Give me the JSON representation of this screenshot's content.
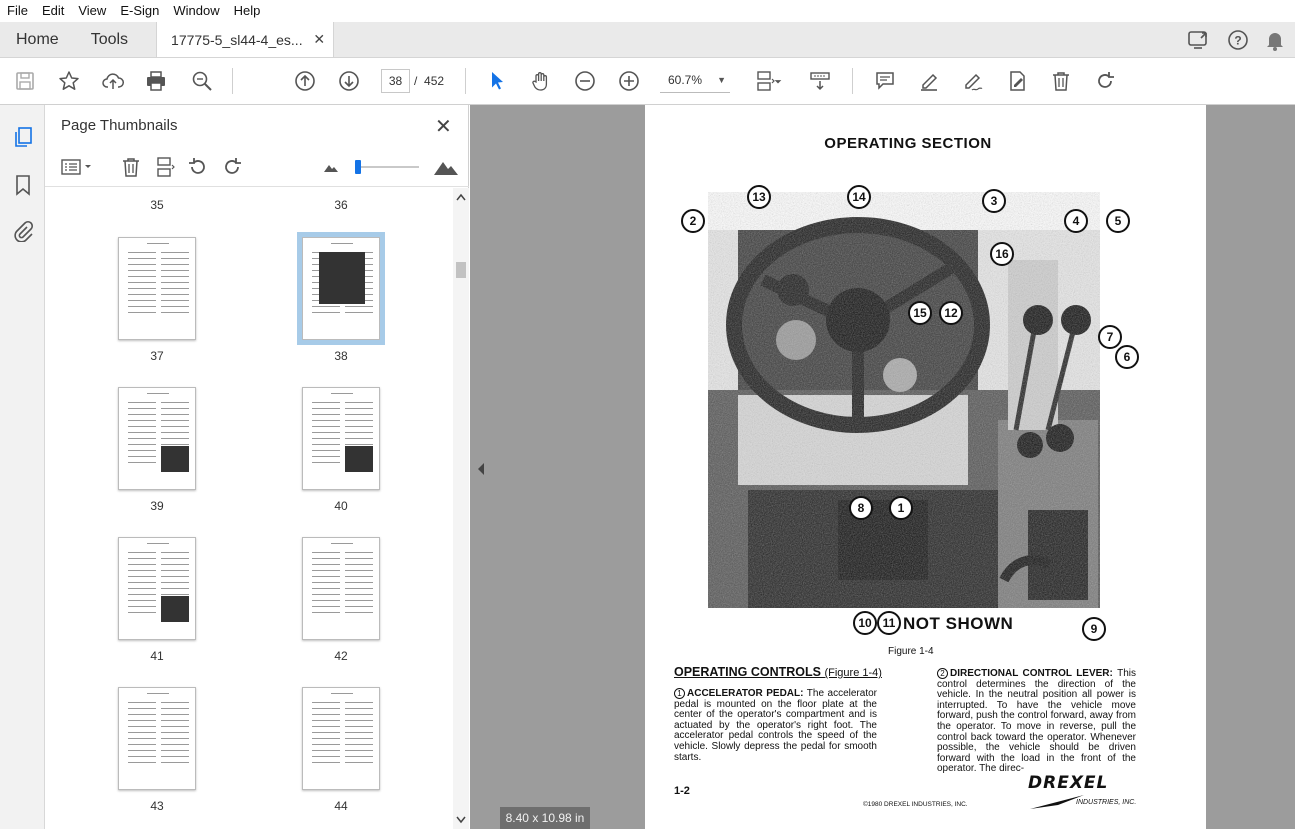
{
  "menu": [
    "File",
    "Edit",
    "View",
    "E-Sign",
    "Window",
    "Help"
  ],
  "tabs": {
    "home": "Home",
    "tools": "Tools",
    "document": "17775-5_sl44-4_es..."
  },
  "toolbar": {
    "current_page": "38",
    "page_sep": "/",
    "total_pages": "452",
    "zoom": "60.7%"
  },
  "panel": {
    "title": "Page Thumbnails",
    "slider_value": 0.02,
    "thumbnails": [
      {
        "label": "35"
      },
      {
        "label": "36"
      },
      {
        "label": "37"
      },
      {
        "label": "38",
        "selected": true
      },
      {
        "label": "39"
      },
      {
        "label": "40"
      },
      {
        "label": "41"
      },
      {
        "label": "42"
      },
      {
        "label": "43"
      },
      {
        "label": "44"
      }
    ]
  },
  "document": {
    "heading": "OPERATING SECTION",
    "not_shown": "NOT SHOWN",
    "figure_caption": "Figure 1-4",
    "callouts": [
      "13",
      "14",
      "2",
      "3",
      "16",
      "4",
      "5",
      "15",
      "12",
      "7",
      "6",
      "8",
      "1",
      "10",
      "11",
      "9"
    ],
    "section_title": "OPERATING CONTROLS",
    "section_ref": "(Figure 1-4)",
    "item1_num": "1",
    "item1_heading": "ACCELERATOR PEDAL:",
    "item1_text": "The accelerator pedal is mounted on the floor plate at the center of the operator's compartment and is actuated by the operator's right foot. The accelerator pedal controls the speed of the vehicle. Slowly depress the pedal for smooth starts.",
    "item2_num": "2",
    "item2_heading": "DIRECTIONAL CONTROL LEVER:",
    "item2_text": "This control determines the direction of the vehicle. In the neutral position all power is interrupted. To have the vehicle move forward, push the control forward, away from the operator. To move in reverse, pull the control back toward the operator. Whenever possible, the vehicle should be driven forward with the load in the front of the operator. The direc-",
    "page_number": "1-2",
    "copyright": "©1980 DREXEL INDUSTRIES, INC.",
    "logo_text": "DREXEL",
    "logo_sub": "INDUSTRIES, INC."
  },
  "status": {
    "page_size": "8.40 x 10.98 in"
  }
}
